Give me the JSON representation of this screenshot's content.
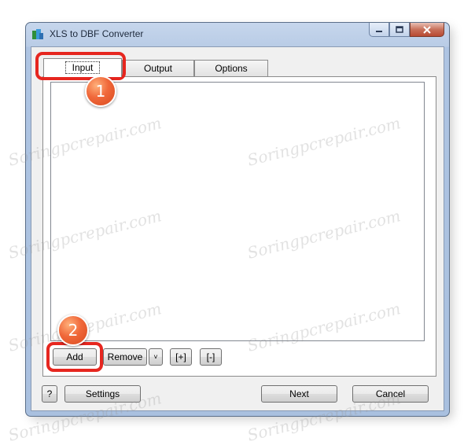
{
  "window": {
    "title": "XLS to DBF Converter"
  },
  "tabs": [
    {
      "label": "Input"
    },
    {
      "label": "Output"
    },
    {
      "label": "Options"
    }
  ],
  "list_buttons": {
    "add": "Add",
    "remove": "Remove",
    "dropdown": "˅",
    "expand": "[+]",
    "collapse": "[-]"
  },
  "footer": {
    "help": "?",
    "settings": "Settings",
    "next": "Next",
    "cancel": "Cancel"
  },
  "annotations": {
    "badge1": "1",
    "badge2": "2"
  },
  "watermark": {
    "text": "Soringpcrepair.com"
  },
  "colors": {
    "highlight": "#e6261f",
    "badge": "#f0683a"
  }
}
